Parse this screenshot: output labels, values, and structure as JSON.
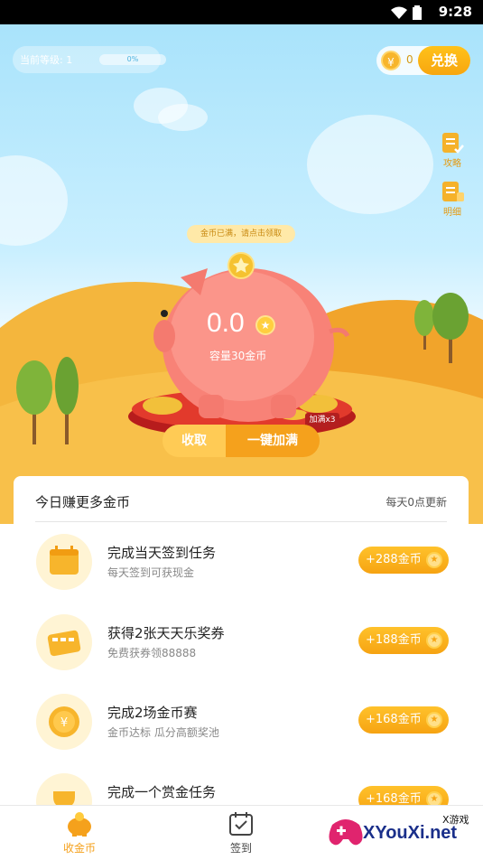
{
  "status_bar": {
    "time": "9:28"
  },
  "level": {
    "label": "当前等级: 1",
    "progress_text": "0%",
    "progress": 0
  },
  "coins": {
    "count": "0",
    "exchange_label": "兑换",
    "coin_symbol": "¥"
  },
  "side_buttons": [
    {
      "label": "攻略"
    },
    {
      "label": "明细"
    }
  ],
  "piggy": {
    "tip": "金币已满，请点击领取",
    "amount": "0.0",
    "capacity": "容量30金币",
    "multiplier_badge": "加满x3"
  },
  "actions": {
    "collect_label": "收取",
    "fill_label": "一键加满"
  },
  "earn_card": {
    "title": "今日赚更多金币",
    "note": "每天0点更新",
    "tasks": [
      {
        "icon": "calendar-icon",
        "title": "完成当天签到任务",
        "desc": "每天签到可获现金",
        "reward": "+288金币"
      },
      {
        "icon": "ticket-icon",
        "title": "获得2张天天乐奖券",
        "desc": "免费获券领88888",
        "reward": "+188金币"
      },
      {
        "icon": "coin-icon",
        "title": "完成2场金币赛",
        "desc": "金币达标 瓜分高额奖池",
        "reward": "+168金币"
      },
      {
        "icon": "trophy-icon",
        "title": "完成一个赏金任务",
        "desc": "",
        "reward": "+168金币"
      }
    ]
  },
  "tabs": [
    {
      "label": "收金币",
      "active": true
    },
    {
      "label": "签到",
      "active": false
    }
  ],
  "watermark": {
    "small": "X游戏",
    "big": "XYouXi.net"
  },
  "colors": {
    "accent": "#f6a312",
    "sky": "#a9e3fb",
    "hill": "#f7b52e"
  }
}
